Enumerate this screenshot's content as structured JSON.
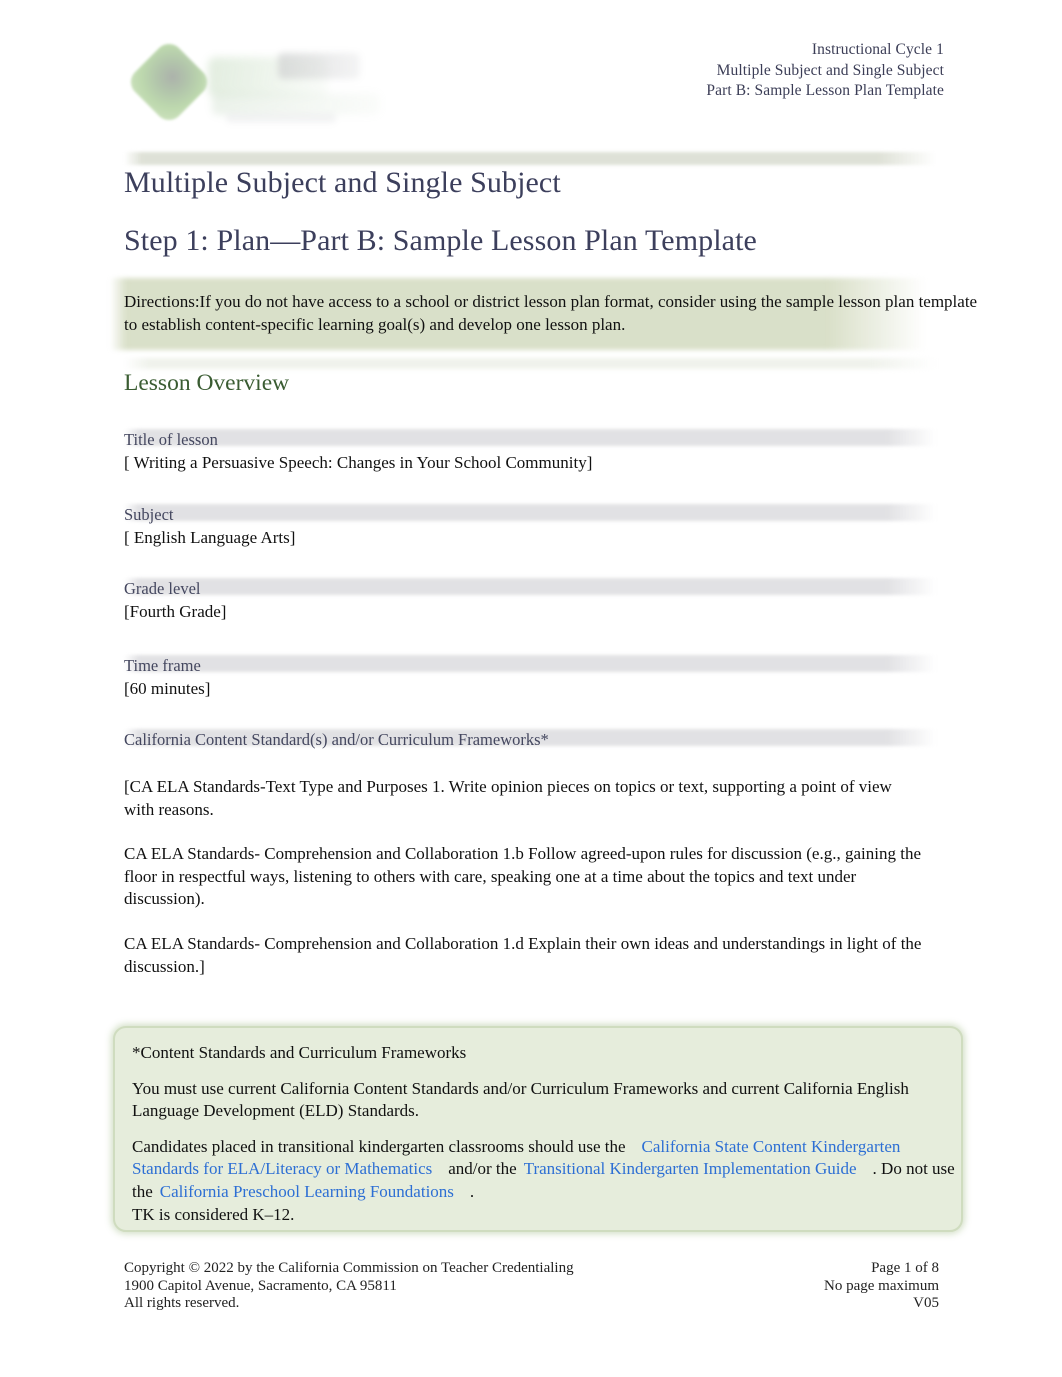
{
  "header": {
    "logo_alt": "california-commission-on-teacher-credentialing-logo",
    "lines": [
      "Instructional Cycle 1",
      "Multiple Subject and Single Subject",
      "Part B: Sample Lesson Plan Template"
    ]
  },
  "titles": {
    "title_1": "Multiple Subject and Single Subject",
    "title_2": "Step 1: Plan—Part B: Sample Lesson Plan Template"
  },
  "directions": {
    "text": "Directions:If you do not have access to a school or district lesson plan format, consider using the sample lesson plan template to establish content-specific learning goal(s) and develop one lesson plan."
  },
  "overview": {
    "heading": "Lesson Overview",
    "fields": [
      {
        "label": "Title of lesson",
        "value": "[ Writing a Persuasive Speech: Changes in Your School Community]"
      },
      {
        "label": "Subject",
        "value": "[ English Language Arts]"
      },
      {
        "label": "Grade level",
        "value": "[Fourth Grade]"
      },
      {
        "label": "Time frame",
        "value": "[60 minutes]"
      },
      {
        "label": "California Content Standard(s) and/or Curriculum Frameworks*",
        "value": ""
      }
    ],
    "standards_paragraphs": [
      "[CA ELA Standards-Text Type and Purposes 1. Write opinion pieces on topics or text, supporting a point of view with reasons.",
      "CA ELA Standards- Comprehension and Collaboration 1.b Follow agreed-upon rules for discussion (e.g., gaining the floor in respectful ways, listening to others with care, speaking one at a time about the topics and text under discussion).",
      "CA ELA Standards- Comprehension and Collaboration 1.d Explain their own ideas and understandings in light of the discussion.]"
    ]
  },
  "note_box": {
    "heading": "*Content Standards and Curriculum Frameworks",
    "paragraph_1": "You must use current California Content Standards and/or Curriculum Frameworks and current California English Language Development (ELD) Standards.",
    "paragraph_2": {
      "part_1": "Candidates placed in transitional kindergarten classrooms should use the",
      "link_1": "California State Content Kindergarten Standards for ELA/Literacy or Mathematics",
      "part_2": "and/or the",
      "link_2": "Transitional Kindergarten Implementation Guide",
      "part_3": ". Do not use the",
      "link_3": "California Preschool Learning Foundations",
      "part_4": ".",
      "part_5": "TK is considered K–12."
    }
  },
  "footer": {
    "left": [
      "Copyright © 2022 by the California Commission on Teacher Credentialing",
      "1900 Capitol Avenue, Sacramento, CA 95811",
      "All rights reserved."
    ],
    "right": [
      "Page 1 of 8",
      "No page maximum",
      "V05"
    ]
  },
  "colors": {
    "title_navy": "#3c3f5c",
    "label_navy": "#44475f",
    "heading_green": "#3a5c32",
    "callout_green": "#d6ddc4",
    "note_box_green": "#e6eddc",
    "note_box_border": "#cfdcbf",
    "link_blue": "#2d6fd4",
    "label_band_gray": "#e0e0e3"
  }
}
